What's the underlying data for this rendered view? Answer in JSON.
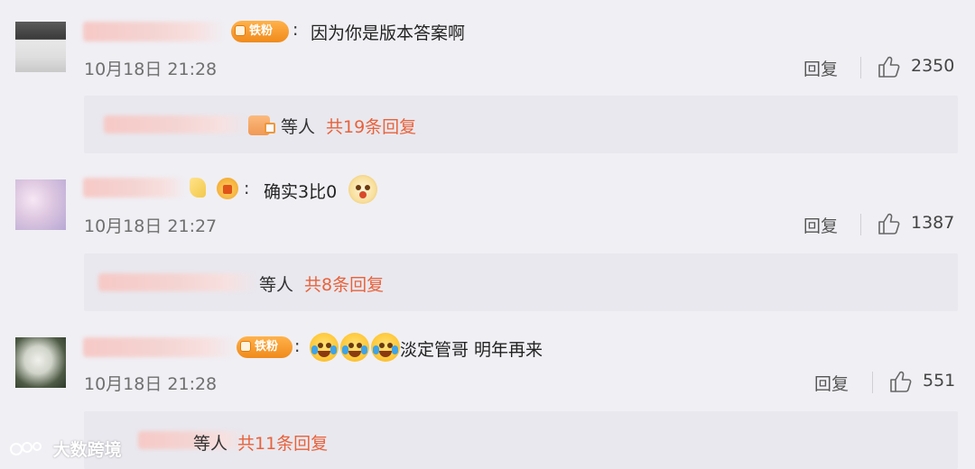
{
  "comments": [
    {
      "badge_label": "铁粉",
      "colon": ":",
      "text": "因为你是版本答案啊",
      "time": "10月18日 21:28",
      "reply_label": "回复",
      "likes": "2350",
      "thread_deng": "等人",
      "thread_count": "共19条回复"
    },
    {
      "colon": ":",
      "text": "确实3比0",
      "time": "10月18日 21:27",
      "reply_label": "回复",
      "likes": "1387",
      "thread_deng": "等人",
      "thread_count": "共8条回复"
    },
    {
      "badge_label": "铁粉",
      "colon": ":",
      "text": "淡定管哥 明年再来",
      "time": "10月18日 21:28",
      "reply_label": "回复",
      "likes": "551",
      "thread_deng": "等人",
      "thread_count": "共11条回复"
    }
  ],
  "watermark": {
    "text": "大数跨境"
  },
  "icons": {
    "like": "thumbs-up-icon",
    "emoji_doge": "doge-emoji-icon",
    "emoji_cry_laugh": "laugh-crying-emoji-icon",
    "fan_badge": "iron-fan-badge-icon",
    "crown": "crown-badge-icon"
  },
  "colors": {
    "background": "#f0eff4",
    "reply_box": "#e9e8ee",
    "accent_link": "#e8623c",
    "badge": "#f08a1c"
  }
}
